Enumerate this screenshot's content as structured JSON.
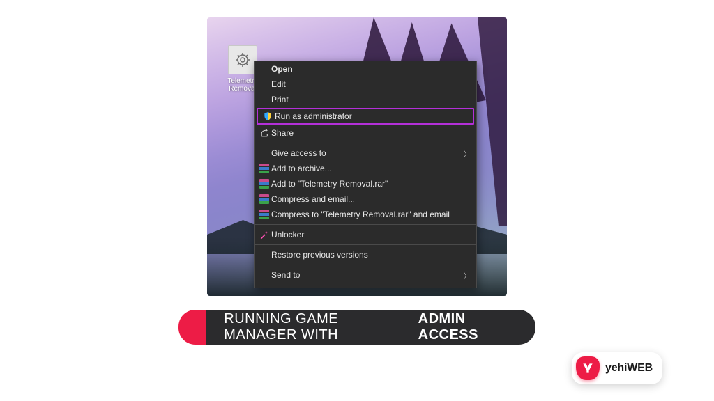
{
  "desktop_icon": {
    "label": "Telemetry Removal"
  },
  "context_menu": {
    "open": "Open",
    "edit": "Edit",
    "print": "Print",
    "run_as_admin": "Run as administrator",
    "share": "Share",
    "give_access_to": "Give access to",
    "add_to_archive": "Add to archive...",
    "add_to_rar": "Add to \"Telemetry Removal.rar\"",
    "compress_email": "Compress and email...",
    "compress_to_rar_email": "Compress to \"Telemetry Removal.rar\" and email",
    "unlocker": "Unlocker",
    "restore_versions": "Restore previous versions",
    "send_to": "Send to"
  },
  "caption": {
    "normal": "RUNNING GAME MANAGER WITH",
    "bold": "ADMIN ACCESS"
  },
  "logo": {
    "prefix": "yehi",
    "suffix": "WEB"
  },
  "colors": {
    "accent": "#ed1c46",
    "highlight": "#b430d9",
    "menu_bg": "#2b2b2b"
  }
}
